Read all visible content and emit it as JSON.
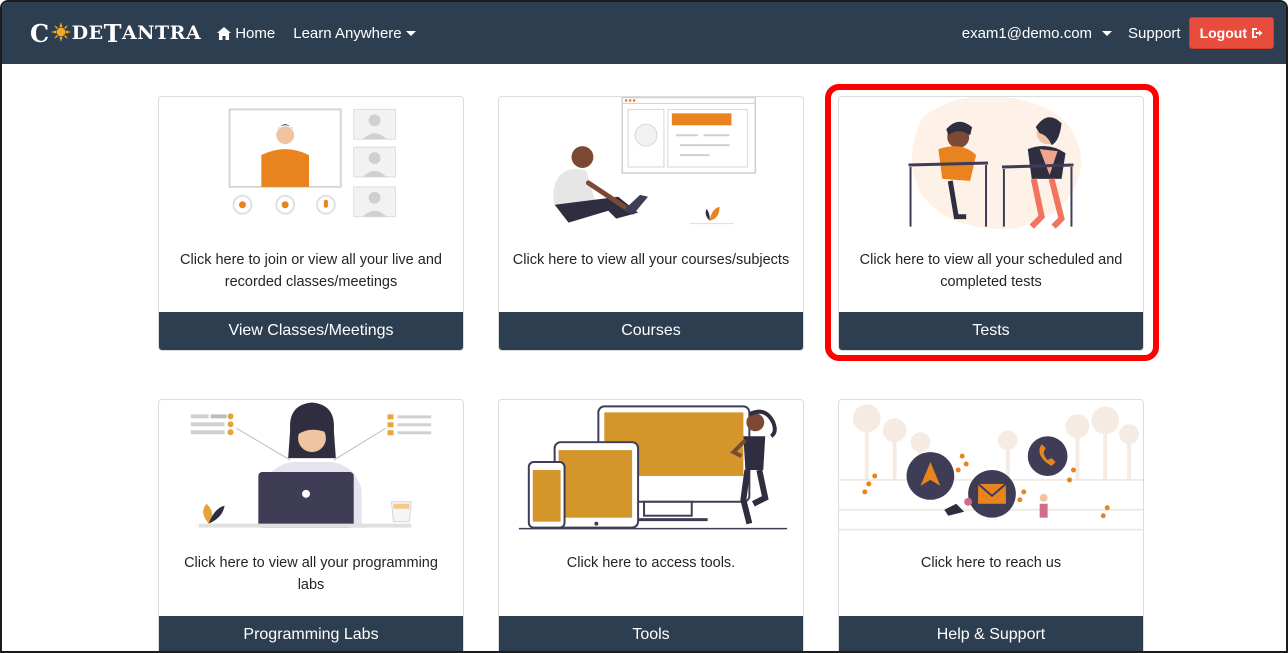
{
  "navbar": {
    "brand_c": "C",
    "brand_de": "DE",
    "brand_t": "T",
    "brand_antra": "ANTRA",
    "home_label": "Home",
    "learn_label": "Learn Anywhere",
    "email_label": "exam1@demo.com",
    "support_label": "Support",
    "logout_label": "Logout"
  },
  "cards": [
    {
      "text": "Click here to join or view all your live and recorded classes/meetings",
      "button": "View Classes/Meetings"
    },
    {
      "text": "Click here to view all your courses/subjects",
      "button": "Courses"
    },
    {
      "text": "Click here to view all your scheduled and completed tests",
      "button": "Tests"
    },
    {
      "text": "Click here to view all your programming labs",
      "button": "Programming Labs"
    },
    {
      "text": "Click here to access tools.",
      "button": "Tools"
    },
    {
      "text": "Click here to reach us",
      "button": "Help & Support"
    }
  ],
  "colors": {
    "navbar_bg": "#2c3e50",
    "logout_bg": "#e74c3c",
    "accent_orange": "#e8831e",
    "illustration_gold": "#d4962a",
    "highlight_border": "#ff0000"
  }
}
